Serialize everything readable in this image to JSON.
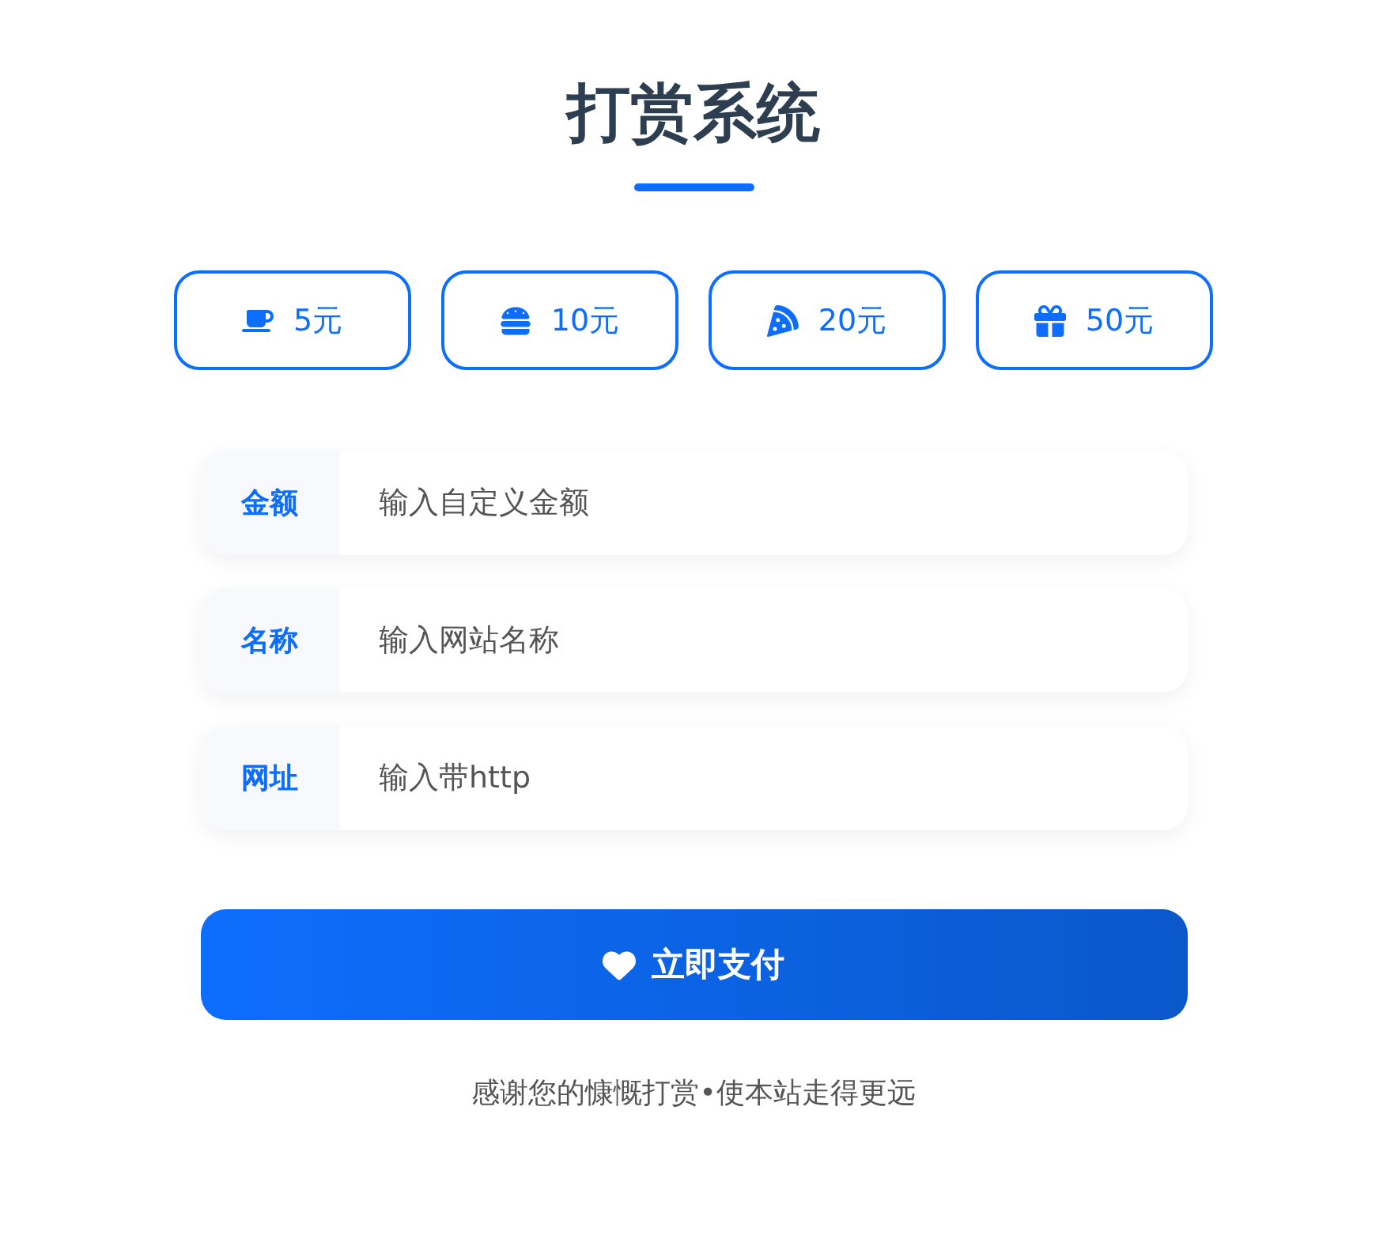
{
  "title": "打赏系统",
  "amounts": [
    {
      "kind": "coffee",
      "label": "5元"
    },
    {
      "kind": "burger",
      "label": "10元"
    },
    {
      "kind": "pizza",
      "label": "20元"
    },
    {
      "kind": "gift",
      "label": "50元"
    }
  ],
  "fields": [
    {
      "label": "金额",
      "placeholder": "输入自定义金额"
    },
    {
      "label": "名称",
      "placeholder": "输入网站名称"
    },
    {
      "label": "网址",
      "placeholder": "输入带http"
    }
  ],
  "pay_button": "立即支付",
  "footer": "感谢您的慷慨打赏•使本站走得更远"
}
